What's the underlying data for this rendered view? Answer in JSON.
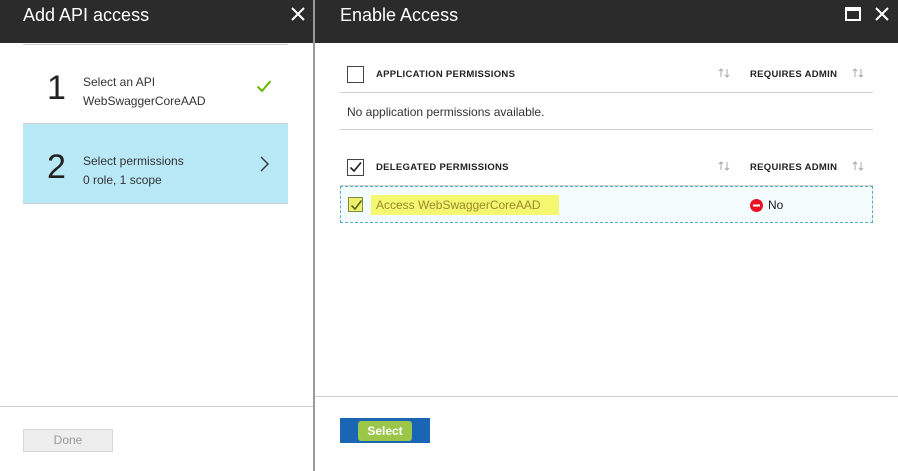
{
  "left_blade": {
    "title": "Add API access",
    "steps": [
      {
        "number": "1",
        "title": "Select an API",
        "subtitle": "WebSwaggerCoreAAD",
        "status_icon": "check-icon"
      },
      {
        "number": "2",
        "title": "Select permissions",
        "subtitle": "0 role, 1 scope",
        "status_icon": "chevron-right-icon"
      }
    ],
    "done_label": "Done"
  },
  "right_blade": {
    "title": "Enable Access",
    "application_permissions": {
      "header": "APPLICATION PERMISSIONS",
      "admin_header": "REQUIRES ADMIN",
      "checked": false,
      "empty_text": "No application permissions available."
    },
    "delegated_permissions": {
      "header": "DELEGATED PERMISSIONS",
      "admin_header": "REQUIRES ADMIN",
      "checked": true,
      "rows": [
        {
          "name": "Access WebSwaggerCoreAAD",
          "requires_admin": "No",
          "checked": true
        }
      ]
    },
    "select_label": "Select"
  },
  "colors": {
    "header_bg": "#2b2b2b",
    "selected_step_bg": "#b9e9f7",
    "check_green": "#6bb700",
    "select_button": "#1b65b5",
    "no_icon_red": "#e81123",
    "highlight_yellow": "#f4f770"
  }
}
